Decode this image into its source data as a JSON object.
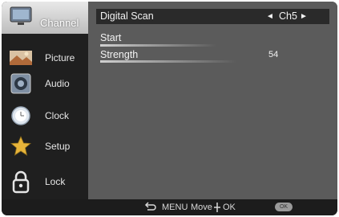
{
  "menu": {
    "items": [
      {
        "label": "Channel",
        "icon": "tv-icon",
        "active": true
      },
      {
        "label": "Picture",
        "icon": "picture-icon",
        "active": false
      },
      {
        "label": "Audio",
        "icon": "speaker-icon",
        "active": false
      },
      {
        "label": "Clock",
        "icon": "clock-icon",
        "active": false
      },
      {
        "label": "Setup",
        "icon": "star-icon",
        "active": false
      },
      {
        "label": "Lock",
        "icon": "lock-icon",
        "active": false
      }
    ]
  },
  "channel_panel": {
    "digital_scan": {
      "label": "Digital Scan",
      "value": "Ch5",
      "left_arrow": "◄",
      "right_arrow": "►"
    },
    "start": {
      "label": "Start"
    },
    "strength": {
      "label": "Strength",
      "value": "54"
    }
  },
  "footer": {
    "menu_hint": "MENU",
    "move_hint": "Move",
    "ok_hint": "OK",
    "ok_button": "OK"
  },
  "colors": {
    "screen_bg": "#4a4a4a",
    "sidebar_bg": "#1f1f1f",
    "panel_bg": "#5b5b5b",
    "highlight_bg": "#2a2a2a"
  }
}
